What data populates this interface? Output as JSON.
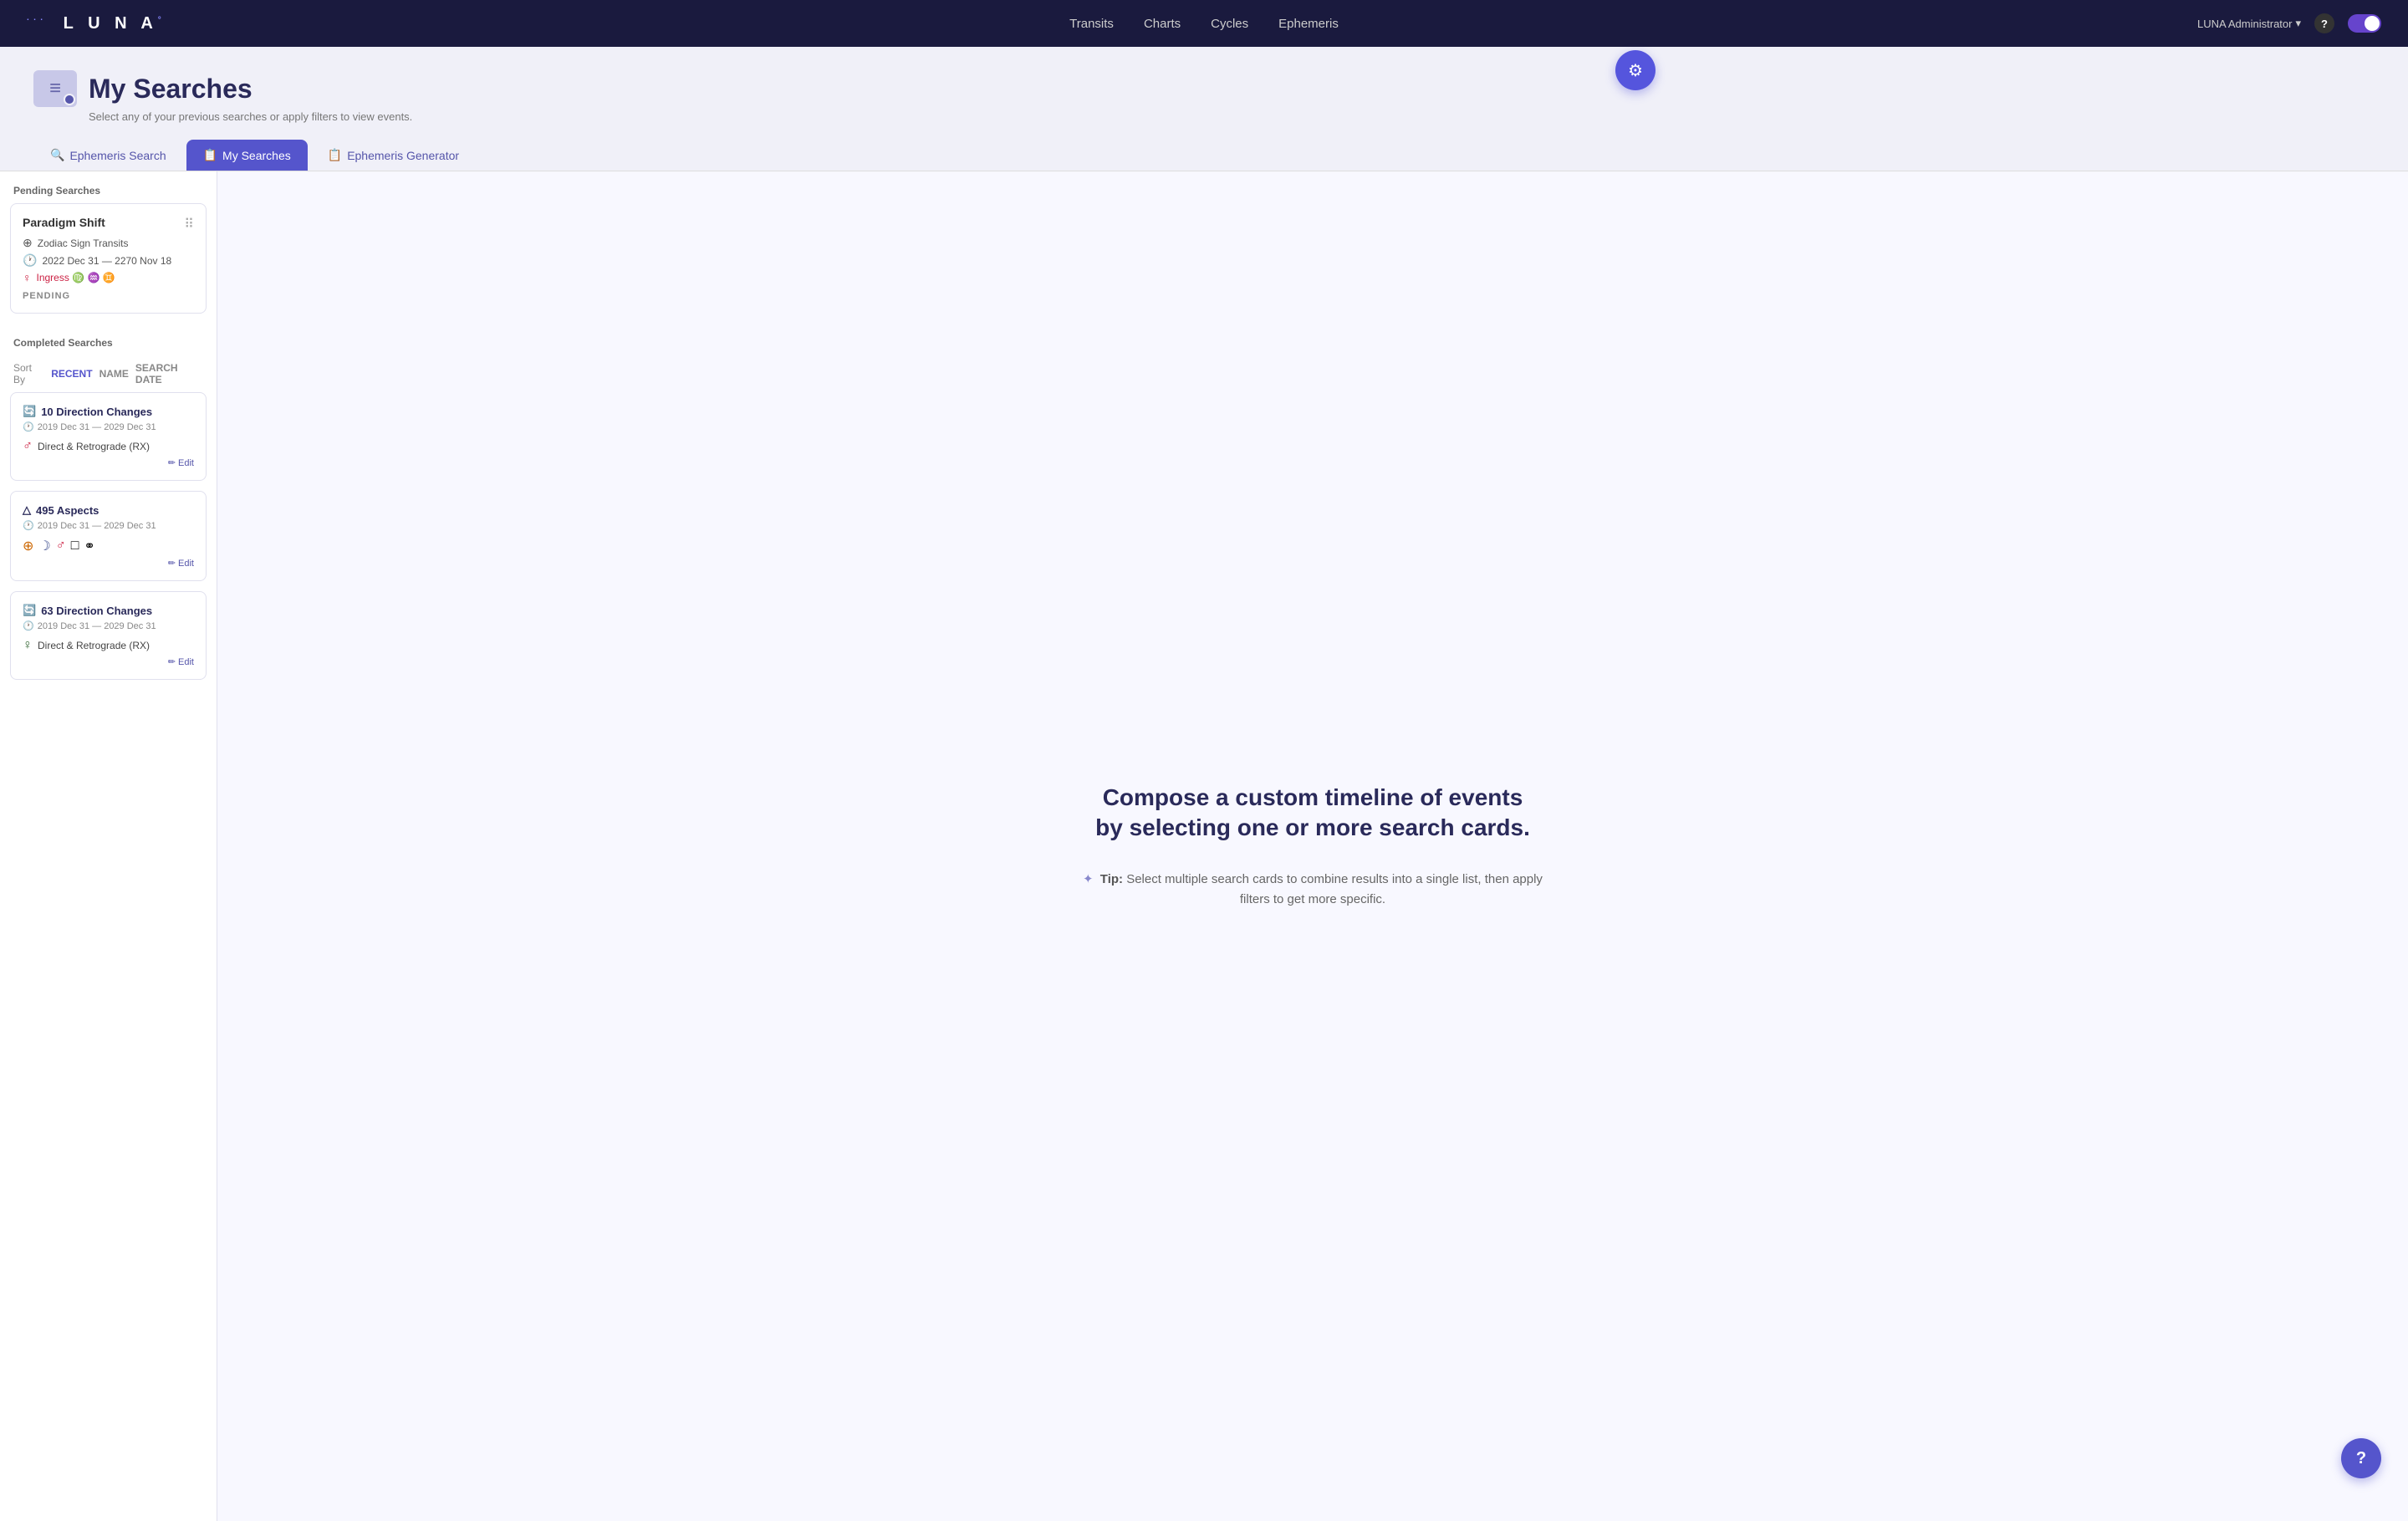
{
  "app": {
    "name": "LUNA",
    "superscript": "°"
  },
  "navbar": {
    "links": [
      "Transits",
      "Charts",
      "Cycles",
      "Ephemeris"
    ],
    "user": "LUNA Administrator",
    "help_label": "?"
  },
  "page": {
    "title": "My Searches",
    "subtitle": "Select any of your previous searches or apply filters to view events.",
    "icon_label": "searches-icon"
  },
  "tabs": [
    {
      "label": "Ephemeris Search",
      "icon": "🔍",
      "active": false
    },
    {
      "label": "My Searches",
      "icon": "📋",
      "active": true
    },
    {
      "label": "Ephemeris Generator",
      "icon": "📋",
      "active": false
    }
  ],
  "sidebar": {
    "pending_section": "Pending Searches",
    "completed_section": "Completed Searches",
    "sort_label": "Sort By",
    "sort_options": [
      "RECENT",
      "NAME",
      "SEARCH DATE"
    ],
    "pending_cards": [
      {
        "title": "Paradigm Shift",
        "rows": [
          {
            "icon": "⊕",
            "text": "Zodiac Sign Transits"
          },
          {
            "icon": "🕐",
            "text": "2022 Dec 31 — 2270 Nov 18"
          }
        ],
        "ingress_row": {
          "icon": "♀",
          "text": "Ingress ♍ ♒ ♊"
        },
        "status": "PENDING"
      }
    ],
    "completed_cards": [
      {
        "title": "10 Direction Changes",
        "date_range": "2019 Dec 31 — 2029 Dec 31",
        "symbols": [
          "♂",
          "Direct & Retrograde (RX)"
        ],
        "symbol_colors": [
          "red"
        ],
        "edit_label": "✏ Edit"
      },
      {
        "title": "495 Aspects",
        "date_range": "2019 Dec 31 — 2029 Dec 31",
        "symbols": [
          "⊕",
          "☽",
          "♂",
          "□",
          "⚭"
        ],
        "symbol_colors": [
          "orange",
          "blue",
          "red",
          "dark",
          "dark"
        ],
        "edit_label": "✏ Edit"
      },
      {
        "title": "63 Direction Changes",
        "date_range": "2019 Dec 31 — 2029 Dec 31",
        "symbols": [
          "♀",
          "Direct & Retrograde (RX)"
        ],
        "symbol_colors": [
          "green"
        ],
        "edit_label": "✏ Edit"
      }
    ]
  },
  "content": {
    "heading_line1": "Compose a custom timeline of events",
    "heading_line2": "by selecting one or more search cards.",
    "tip_prefix": "✦ Tip:",
    "tip_text": "Select multiple search cards to combine results into a single list, then apply filters to get more specific."
  },
  "fab": {
    "icon": "⚙",
    "label": "settings"
  },
  "help_fab": {
    "label": "?"
  }
}
